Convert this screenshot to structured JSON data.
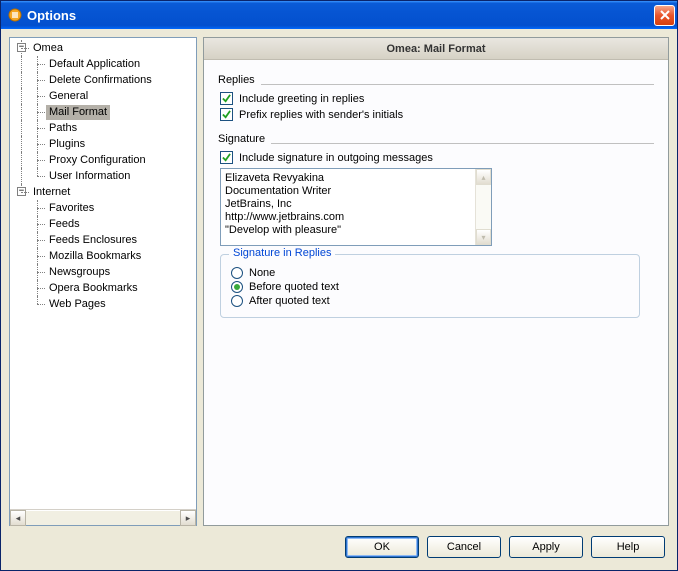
{
  "window": {
    "title": "Options"
  },
  "tree": {
    "root1": "Omea",
    "root1_items": [
      "Default Application",
      "Delete Confirmations",
      "General",
      "Mail Format",
      "Paths",
      "Plugins",
      "Proxy Configuration",
      "User Information"
    ],
    "root1_selected_index": 3,
    "root2": "Internet",
    "root2_items": [
      "Favorites",
      "Feeds",
      "Feeds Enclosures",
      "Mozilla Bookmarks",
      "Newsgroups",
      "Opera Bookmarks",
      "Web Pages"
    ]
  },
  "panel": {
    "title": "Omea: Mail Format",
    "replies_section": "Replies",
    "include_greeting": {
      "label": "Include greeting in replies",
      "checked": true
    },
    "prefix_initials": {
      "label": "Prefix replies with sender's initials",
      "checked": true
    },
    "signature_section": "Signature",
    "include_signature": {
      "label": "Include signature in outgoing messages",
      "checked": true
    },
    "signature_text": "Elizaveta Revyakina\nDocumentation Writer\nJetBrains, Inc\nhttp://www.jetbrains.com\n\"Develop with pleasure\"",
    "sig_replies_group": "Signature in Replies",
    "radio_none": "None",
    "radio_before": "Before quoted text",
    "radio_after": "After quoted text",
    "radio_selected": "before"
  },
  "buttons": {
    "ok": "OK",
    "cancel": "Cancel",
    "apply": "Apply",
    "help": "Help"
  }
}
